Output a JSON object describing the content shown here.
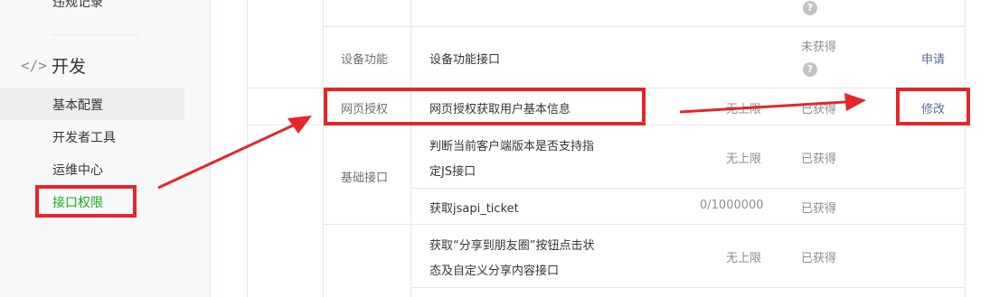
{
  "sidebar": {
    "top_partial_item": "违规记录",
    "group": {
      "icon": "code-icon",
      "icon_glyph": "</>",
      "title": "开发"
    },
    "items": [
      {
        "label": "基本配置"
      },
      {
        "label": "开发者工具"
      },
      {
        "label": "运维中心"
      },
      {
        "label": "接口权限"
      }
    ]
  },
  "table": {
    "top_row_help": "?",
    "rows": {
      "device": {
        "category": "设备功能",
        "name": "设备功能接口",
        "status": "未获得",
        "help": "?",
        "action": "申请"
      },
      "web_auth": {
        "category": "网页授权",
        "name": "网页授权获取用户基本信息",
        "limit": "无上限",
        "status": "已获得",
        "action": "修改"
      },
      "basic_category": "基础接口",
      "basic_1": {
        "name_line1": "判断当前客户端版本是否支持指",
        "name_line2": "定JS接口",
        "limit": "无上限",
        "status": "已获得"
      },
      "basic_2": {
        "name": "获取jsapi_ticket",
        "limit": "0/1000000",
        "status": "已获得"
      },
      "share": {
        "name_line1": "获取“分享到朋友圈”按钮点击状",
        "name_line2": "态及自定义分享内容接口",
        "limit": "无上限",
        "status": "已获得"
      }
    }
  },
  "colors": {
    "annotation_red": "#e5262b",
    "active_green": "#1aad19",
    "link_blue": "#576b95",
    "border": "#e7e7eb"
  }
}
